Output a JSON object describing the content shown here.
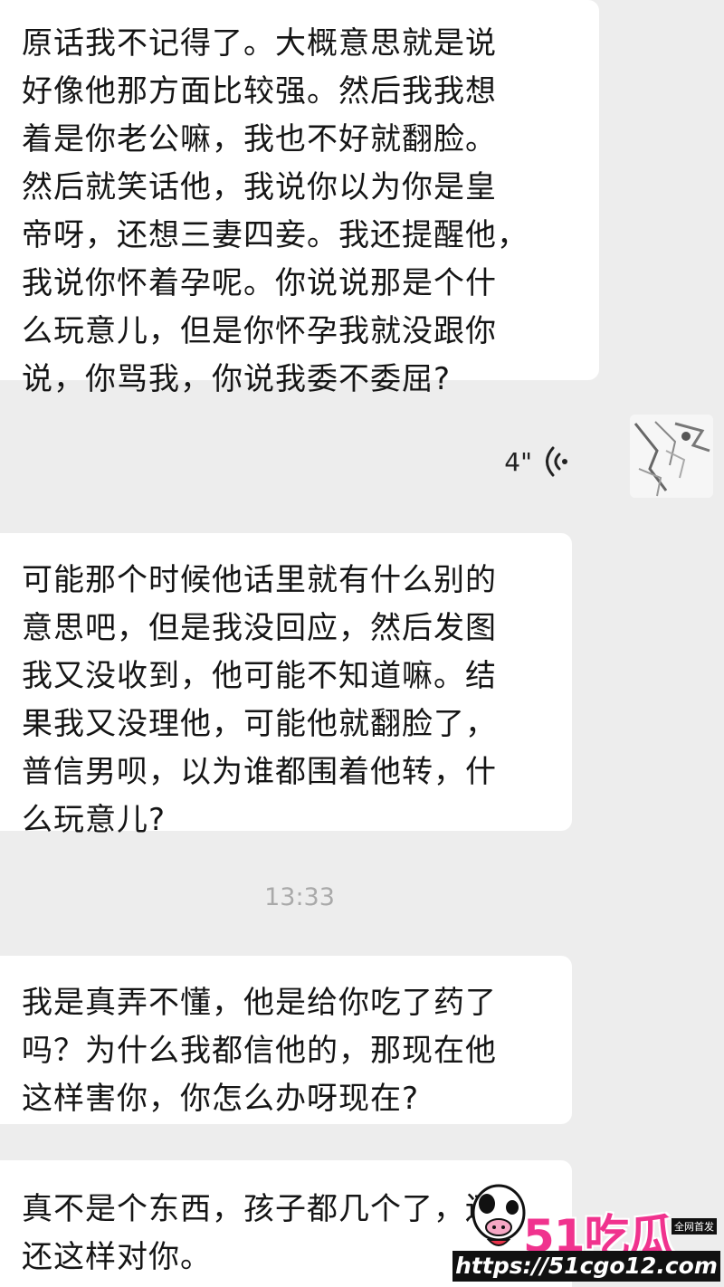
{
  "messages": [
    {
      "id": "m1",
      "side": "left",
      "text": "原话我不记得了。大概意思就是说\n好像他那方面比较强。然后我我想\n着是你老公嘛，我也不好就翻脸。\n然后就笑话他，我说你以为你是皇\n帝呀，还想三妻四妾。我还提醒他，\n我说你怀着孕呢。你说说那是个什\n么玩意儿，但是你怀孕我就没跟你\n说，你骂我，你说我委不委屈?"
    },
    {
      "id": "m2",
      "side": "right",
      "type": "voice",
      "duration": "4\""
    },
    {
      "id": "m3",
      "side": "left",
      "text": "可能那个时候他话里就有什么别的\n意思吧，但是我没回应，然后发图\n我又没收到，他可能不知道嘛。结\n果我又没理他，可能他就翻脸了，\n普信男呗，以为谁都围着他转，什\n么玩意儿?"
    },
    {
      "id": "m4",
      "side": "left",
      "text": "我是真弄不懂，他是给你吃了药了\n吗？为什么我都信他的，那现在他\n这样害你，你怎么办呀现在?"
    },
    {
      "id": "m5",
      "side": "left",
      "text": "真不是个东西，孩子都几个了，还\n还这样对你。"
    }
  ],
  "timestamp": "13:33",
  "watermark": {
    "brand": "51吃瓜",
    "badge": "全网首发",
    "url": "https://51cgo12.com",
    "mascot_icon": "cow-mascot-icon"
  },
  "colors": {
    "background": "#ededed",
    "bubble_left": "#ffffff",
    "timestamp": "#a9a9a9",
    "brand_pink": "#f0338e"
  }
}
